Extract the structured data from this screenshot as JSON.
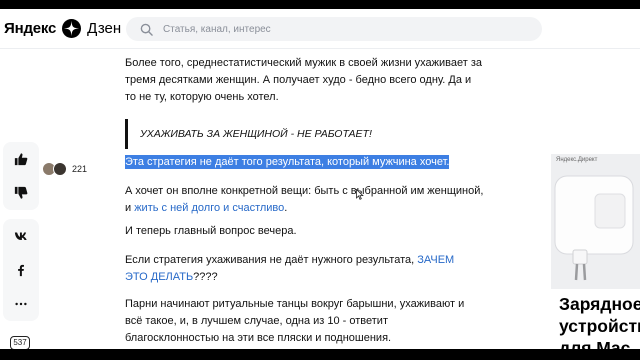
{
  "header": {
    "logo_word": "Яндекс",
    "logo_product": "Дзен",
    "search_placeholder": "Статья, канал, интерес"
  },
  "rail": {
    "likes_count": "221",
    "counter_badge": "537",
    "icons": [
      "thumbs-up-icon",
      "thumbs-down-icon",
      "vk-icon",
      "facebook-icon",
      "more-icon"
    ]
  },
  "article": {
    "paragraph1": "Более того, среднестатистический мужик в своей жизни ухаживает за тремя десятками женщин. А получает худо - бедно всего одну. Да и то не ту, которую очень хотел.",
    "quote": "УХАЖИВАТЬ ЗА ЖЕНЩИНОЙ - НЕ РАБОТАЕТ!",
    "highlight": "Эта стратегия не даёт того результата, который мужчина хочет.",
    "paragraph3_text": "А хочет он вполне конкретной вещи: быть с выбранной им женщиной, и ",
    "paragraph3_link": "жить с ней долго и счастливо",
    "paragraph3_end": ".",
    "paragraph4": "И теперь главный вопрос вечера.",
    "paragraph5_text": "Если стратегия ухаживания не даёт нужного результата, ",
    "paragraph5_link": "ЗАЧЕМ ЭТО ДЕЛАТЬ",
    "paragraph5_end": "????",
    "paragraph6": "Парни начинают ритуальные танцы вокруг барышни, ухаживают и всё такое, и, в лучшем случае, одна из 10 - ответит благосклонностью на эти все пляски и подношения."
  },
  "ad": {
    "tag": "Яндекс.Директ",
    "title_line1": "Зарядное",
    "title_line2": "устройство",
    "title_line3": "для Mac"
  },
  "colors": {
    "highlight_bg": "#3d7fe3",
    "link": "#2769c8"
  }
}
